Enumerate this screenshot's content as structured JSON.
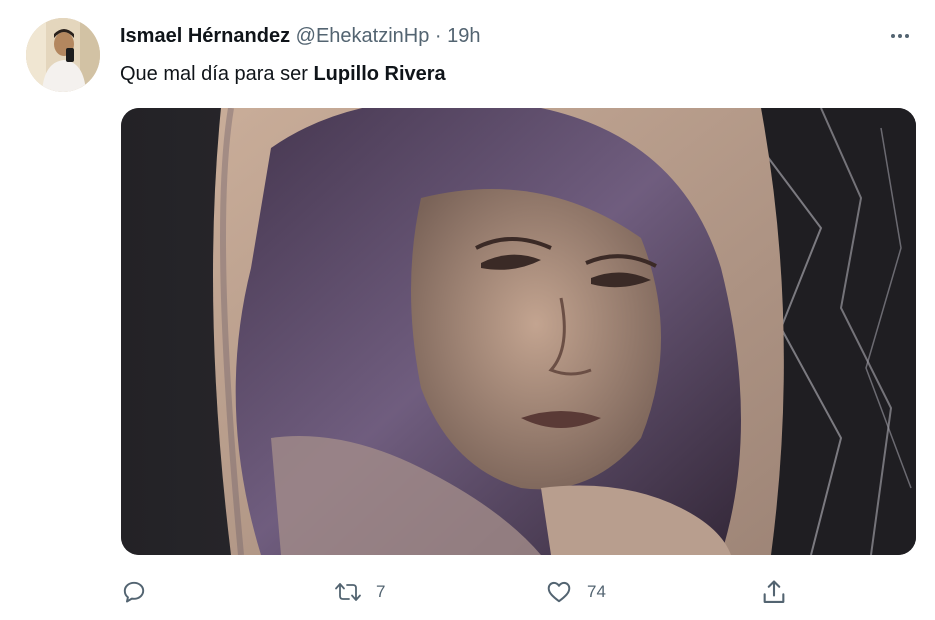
{
  "tweet": {
    "author_name": "Ismael Hérnandez",
    "handle": "@EhekatzinHp",
    "separator": "·",
    "time": "19h",
    "text_prefix": "Que mal día para ser ",
    "text_bold": "Lupillo Rivera"
  },
  "actions": {
    "reply_icon": "reply-icon",
    "retweet_icon": "retweet-icon",
    "retweet_count": "7",
    "like_icon": "heart-icon",
    "like_count": "74",
    "share_icon": "share-icon"
  },
  "colors": {
    "text_primary": "#0f1419",
    "text_secondary": "#536471"
  }
}
